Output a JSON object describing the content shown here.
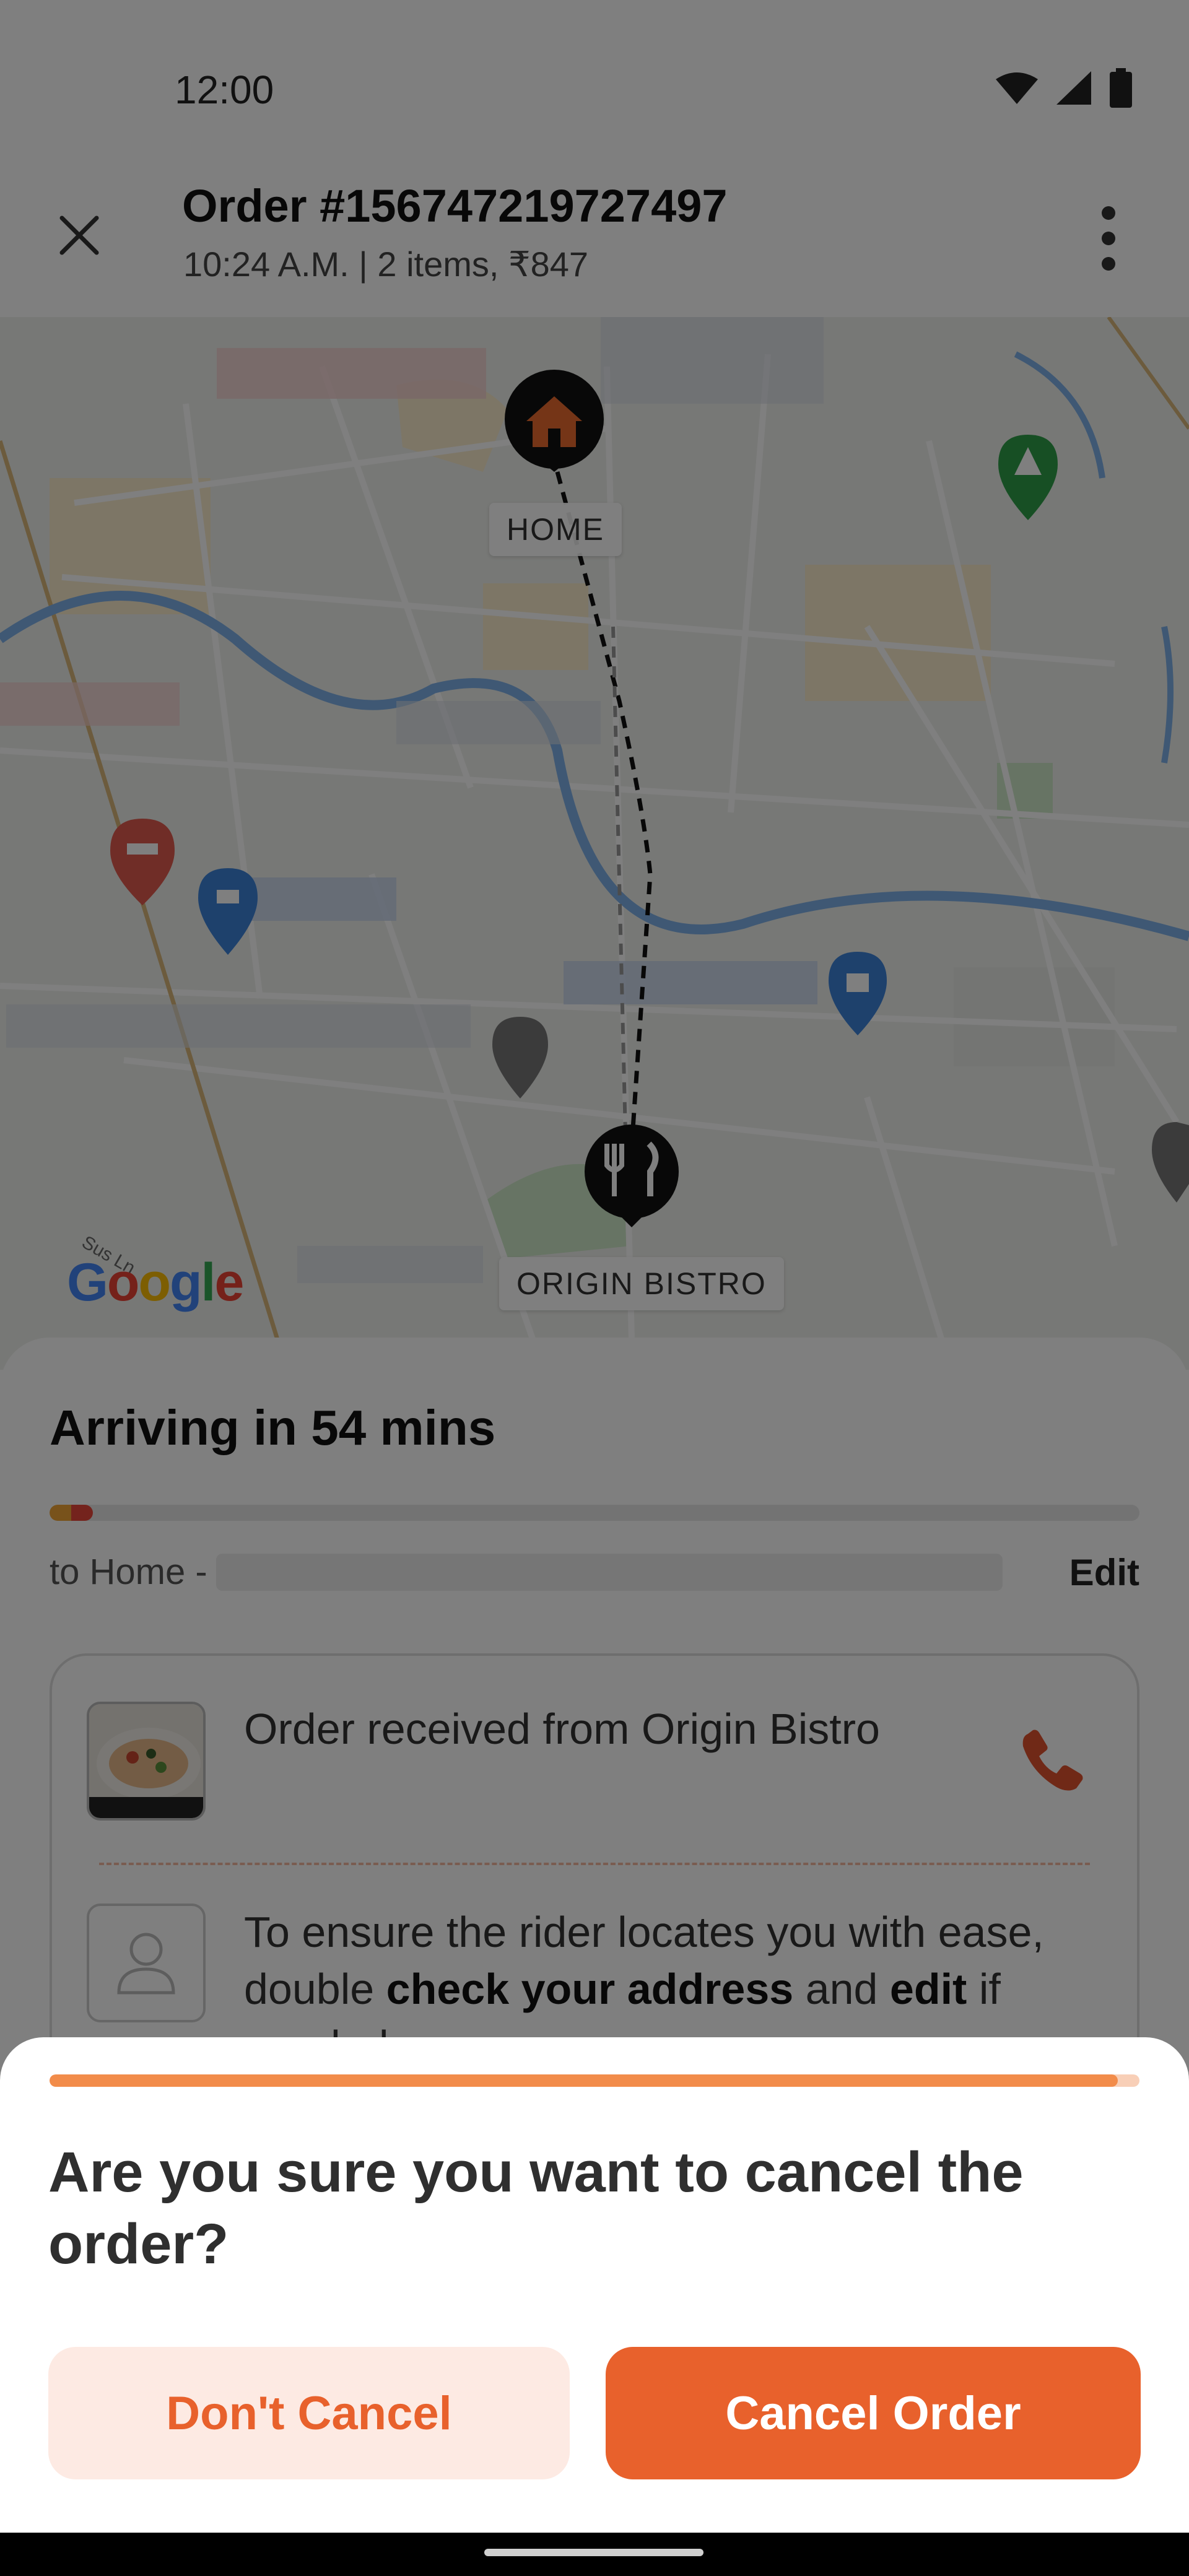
{
  "status_bar": {
    "time": "12:00",
    "icons": [
      "wifi-icon",
      "signal-icon",
      "battery-icon"
    ]
  },
  "header": {
    "title": "Order #156747219727497",
    "subtitle": "10:24 A.M. | 2 items, ₹847",
    "close_icon": "close-icon",
    "more_icon": "more-vertical-icon"
  },
  "map": {
    "home_label": "HOME",
    "restaurant_label": "ORIGIN BISTRO",
    "google_logo": "Google",
    "street_label": "Sus Ln"
  },
  "tracking": {
    "eta": "Arriving in 54 mins",
    "progress": 0.04,
    "address_prefix": "to Home -",
    "edit_label": "Edit",
    "received_text": "Order received from Origin Bistro",
    "rider_text_1": "To ensure the rider locates you with ease, double ",
    "rider_text_bold": "check your address",
    "rider_text_2": " and ",
    "rider_text_bold2": "edit",
    "rider_text_3": " if needed."
  },
  "dialog": {
    "progress": 0.98,
    "question": "Are you sure you want to cancel the order?",
    "dont_cancel_label": "Don't Cancel",
    "cancel_order_label": "Cancel Order"
  },
  "colors": {
    "accent": "#e8612c",
    "accent_light": "#fdeae3",
    "progress_orange": "#f1a536",
    "progress_red": "#e8473a",
    "dialog_progress": "#f28c4a"
  }
}
